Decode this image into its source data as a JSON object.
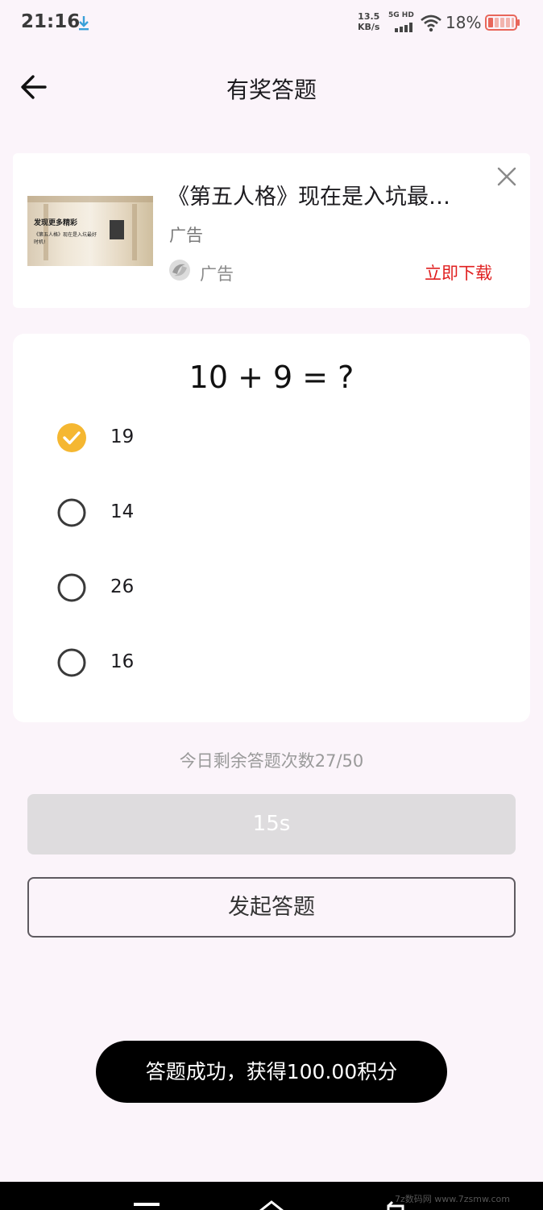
{
  "status_bar": {
    "time": "21:16",
    "net_speed_value": "13.5",
    "net_speed_unit": "KB/s",
    "network_label": "5G HD",
    "battery_percent": "18%"
  },
  "app_bar": {
    "title": "有奖答题"
  },
  "ad": {
    "title": "《第五人格》现在是入坑最…",
    "subtitle": "广告",
    "label": "广告",
    "download_label": "立即下载",
    "thumb_line1": "发现更多精彩",
    "thumb_line2": "《第五人格》现在是入坑最好时机!"
  },
  "quiz": {
    "question": "10 + 9 = ?",
    "options": [
      {
        "label": "19",
        "selected": true
      },
      {
        "label": "14",
        "selected": false
      },
      {
        "label": "26",
        "selected": false
      },
      {
        "label": "16",
        "selected": false
      }
    ],
    "remaining_text": "今日剩余答题次数27/50",
    "timer_label": "15s",
    "start_button_label": "发起答题"
  },
  "toast": {
    "message": "答题成功，获得100.00积分"
  },
  "nav": {
    "watermark": "7z数码网 www.7zsmw.com"
  },
  "colors": {
    "background": "#fbf4fa",
    "selected_accent": "#f5b731",
    "download_red": "#e02020",
    "toast_bg": "#000000"
  }
}
